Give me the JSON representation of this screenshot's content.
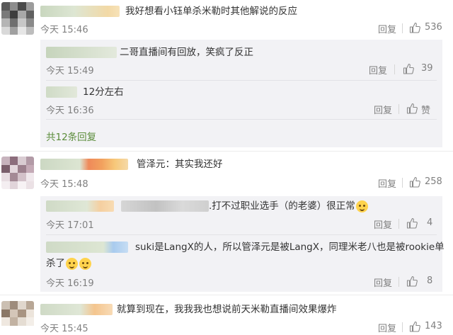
{
  "actions": {
    "reply": "回复"
  },
  "comments": [
    {
      "text": "我好想看小钰单杀米勒时其他解说的反应",
      "time": "今天 15:46",
      "likes": "536",
      "replies": [
        {
          "text": "二哥直播间有回放，笑疯了反正",
          "time": "今天 15:49",
          "likes": "39"
        },
        {
          "text": "12分左右",
          "time": "今天 16:36",
          "likes": "赞"
        }
      ],
      "more": "共12条回复"
    },
    {
      "text": "管泽元：其实我还好",
      "time": "今天 15:48",
      "likes": "258",
      "replies": [
        {
          "text": ".打不过职业选手（的老婆）很正常",
          "time": "今天 17:01",
          "likes": "4"
        },
        {
          "text": "suki是LangX的人，所以管泽元是被LangX，同理米老八也是被rookie单",
          "text2": "杀了",
          "time": "今天 16:19",
          "likes": "8"
        }
      ]
    },
    {
      "text": "就算到现在，我我我也想说前天米勒直播间效果爆炸",
      "time": "今天 15:45",
      "likes": "143"
    }
  ],
  "colors": {
    "link_green": "#5b8c3a",
    "meta_gray": "#808080",
    "reply_bg": "#f2f2f5"
  },
  "icons": {
    "like": "thumbs-up-icon",
    "emoji": "dog-face-emoji-icon"
  }
}
